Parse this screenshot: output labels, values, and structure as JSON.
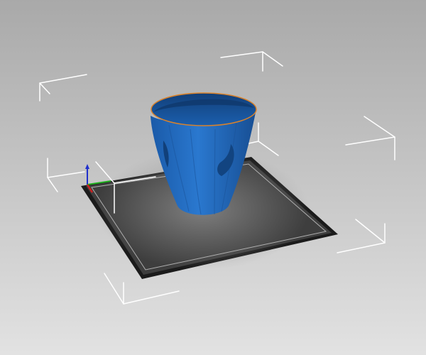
{
  "viewport": {
    "background_top": "#a9a9a9",
    "background_bottom": "#e2e2e2",
    "view_mode": "3d-perspective",
    "model": "cup"
  },
  "build_plate": {
    "plate_color": "#3e3e3e",
    "frame_color": "#1b1b1b",
    "outline_color": "#b0b0b0",
    "glow_color": "#8a8a8a"
  },
  "model": {
    "name": "cup",
    "color": "#1e64b6",
    "edge_color": "#d9822b",
    "interior_color": "#164f93",
    "selected": true
  },
  "selection_box": {
    "color": "#ffffff",
    "visible": true
  },
  "axes": {
    "x_color": "#cc2020",
    "y_color": "#20b020",
    "z_color": "#2030cc"
  }
}
